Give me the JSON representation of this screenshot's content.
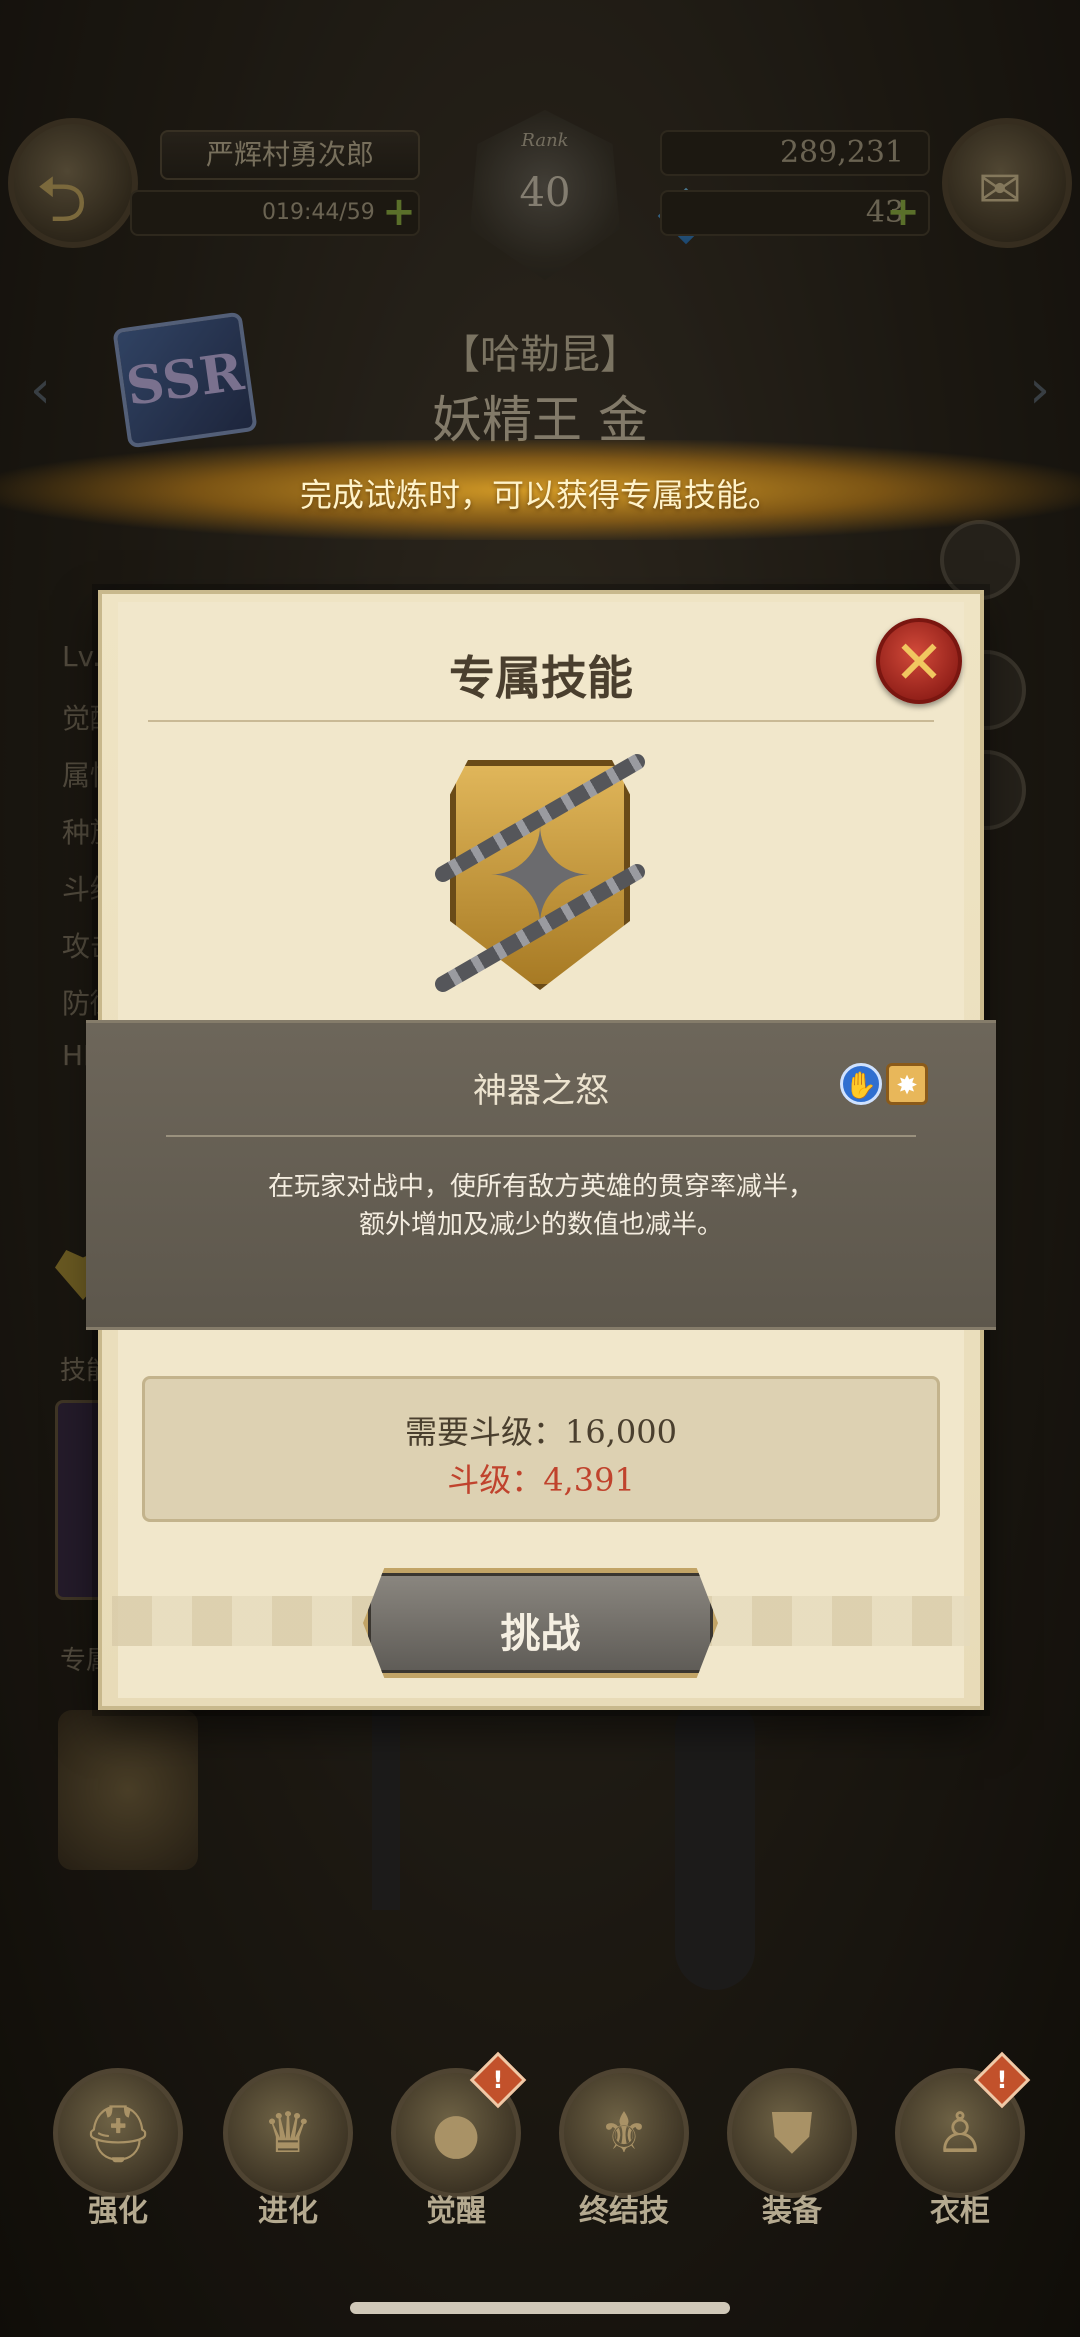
{
  "topbar": {
    "player_name": "严辉村勇次郎",
    "stamina": "019:44/59",
    "rank_label": "Rank",
    "rank_level": "40",
    "gold": "289,231",
    "gems": "43"
  },
  "hero": {
    "rarity": "SSR",
    "subtitle": "【哈勒昆】",
    "title": "妖精王 金"
  },
  "banner": {
    "text": "完成试炼时，可以获得专属技能。"
  },
  "side_stats": [
    "Lv.",
    "觉醒",
    "属性",
    "种族",
    "斗级",
    "攻击",
    "防御",
    "HP"
  ],
  "side_labels": {
    "skills": "技能",
    "exclusive": "专属"
  },
  "modal": {
    "title": "专属技能",
    "skill_name": "神器之怒",
    "description_line1": "在玩家对战中，使所有敌方英雄的贯穿率减半，",
    "description_line2": "额外增加及减少的数值也减半。",
    "required_level": "需要斗级：16,000",
    "current_level": "斗级：4,391",
    "challenge_label": "挑战"
  },
  "bottom_nav": [
    {
      "label": "强化",
      "icon": "helmet-up-icon",
      "alert": ""
    },
    {
      "label": "进化",
      "icon": "evolve-icon",
      "alert": ""
    },
    {
      "label": "觉醒",
      "icon": "awaken-orb-icon",
      "alert": "!"
    },
    {
      "label": "终结技",
      "icon": "ultimate-icon",
      "alert": ""
    },
    {
      "label": "装备",
      "icon": "equipment-icon",
      "alert": ""
    },
    {
      "label": "衣柜",
      "icon": "wardrobe-icon",
      "alert": "!"
    }
  ],
  "colors": {
    "banner_gold": "#f2b028",
    "current_level_red": "#c0432d",
    "close_red": "#b0281f",
    "pvp_blue": "#2f6fd0"
  }
}
